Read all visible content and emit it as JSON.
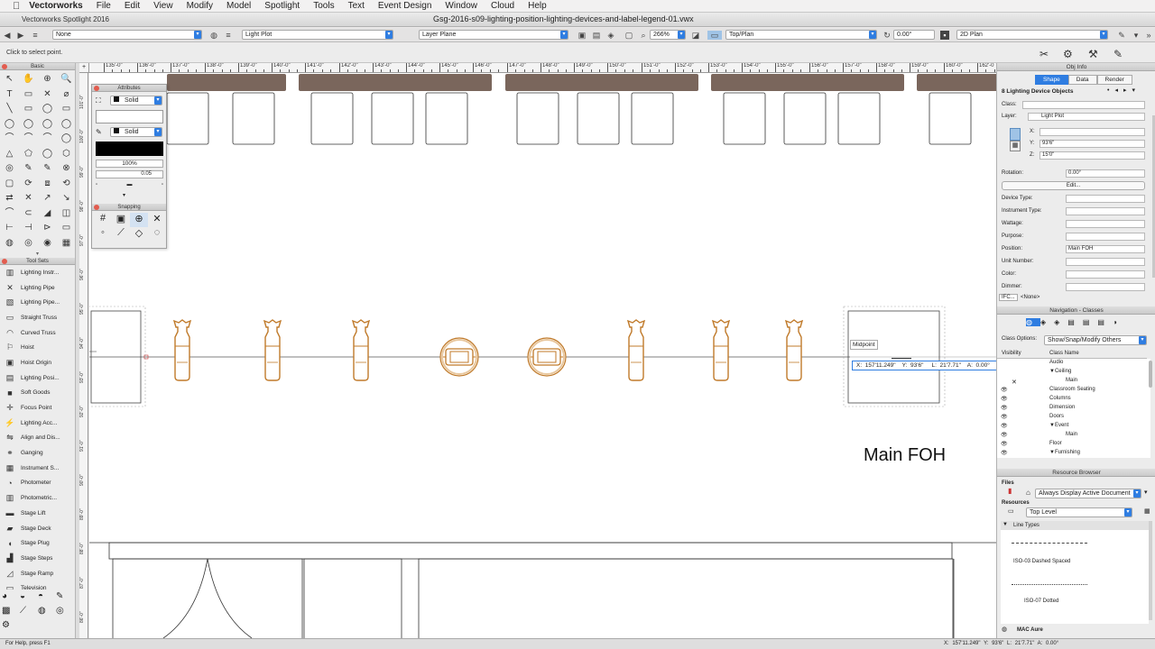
{
  "menubar": {
    "apple": "",
    "app_name": "Vectorworks",
    "items": [
      "File",
      "Edit",
      "View",
      "Modify",
      "Model",
      "Spotlight",
      "Tools",
      "Text",
      "Event Design",
      "Window",
      "Cloud",
      "Help"
    ]
  },
  "window": {
    "product": "Vectorworks Spotlight 2016",
    "document": "Gsg-2016-s09-lighting-position-lighting-devices-and-label-legend-01.vwx"
  },
  "viewbar": {
    "class_select": "None",
    "layer_select": "Light Plot",
    "plane_select": "Layer Plane",
    "zoom": "266%",
    "view_select": "Top/Plan",
    "angle": "0.00°",
    "render_select": "2D Plan"
  },
  "modebar": {
    "hint": "Click to select point."
  },
  "palettes": {
    "basic_title": "Basic",
    "basic_tools": [
      "↖",
      "✋",
      "⊕",
      "🔍",
      "T",
      "▭",
      "✕",
      "⌀",
      "╲",
      "▭",
      "◯",
      "▭",
      "◯",
      "◯",
      "◯",
      "◯",
      "⌒",
      "⌒",
      "⌒",
      "◯",
      "△",
      "⬠",
      "◯",
      "⬡",
      "◎",
      "✎",
      "✎",
      "⊗",
      "▢",
      "⟳",
      "⧈",
      "⟲",
      "⇄",
      "✕",
      "↗",
      "↘",
      "⌒",
      "⊂",
      "◢",
      "◫",
      "⊢",
      "⊣",
      "⊳",
      "▭",
      "◍",
      "◎",
      "◉",
      "▦"
    ],
    "toolsets_title": "Tool Sets",
    "toolsets": [
      {
        "icon": "▥",
        "label": "Lighting Instr..."
      },
      {
        "icon": "✕",
        "label": "Lighting Pipe"
      },
      {
        "icon": "▧",
        "label": "Lighting Pipe..."
      },
      {
        "icon": "▭",
        "label": "Straight Truss"
      },
      {
        "icon": "◠",
        "label": "Curved Truss"
      },
      {
        "icon": "⚐",
        "label": "Hoist"
      },
      {
        "icon": "▣",
        "label": "Hoist Origin"
      },
      {
        "icon": "▤",
        "label": "Lighting Posi..."
      },
      {
        "icon": "■",
        "label": "Soft Goods"
      },
      {
        "icon": "✛",
        "label": "Focus Point"
      },
      {
        "icon": "⚡",
        "label": "Lighting Acc..."
      },
      {
        "icon": "⇋",
        "label": "Align and Dis..."
      },
      {
        "icon": "⚭",
        "label": "Ganging"
      },
      {
        "icon": "▦",
        "label": "Instrument S..."
      },
      {
        "icon": "◔",
        "label": "Photometer"
      },
      {
        "icon": "▥",
        "label": "Photometric..."
      },
      {
        "icon": "▬",
        "label": "Stage Lift"
      },
      {
        "icon": "▰",
        "label": "Stage Deck"
      },
      {
        "icon": "◖",
        "label": "Stage Plug"
      },
      {
        "icon": "▟",
        "label": "Stage Steps"
      },
      {
        "icon": "◿",
        "label": "Stage Ramp"
      },
      {
        "icon": "▭",
        "label": "Television"
      }
    ],
    "attributes": {
      "title": "Attributes",
      "fill_style": "Solid",
      "pen_style": "Solid",
      "opacity": "100%",
      "line_weight": "0.05"
    },
    "snapping_title": "Snapping"
  },
  "ruler": {
    "h_labels": [
      "135'-0\"",
      "136'-0\"",
      "137'-0\"",
      "138'-0\"",
      "139'-0\"",
      "140'-0\"",
      "141'-0\"",
      "142'-0\"",
      "143'-0\"",
      "144'-0\"",
      "145'-0\"",
      "146'-0\"",
      "147'-0\"",
      "148'-0\"",
      "149'-0\"",
      "150'-0\"",
      "151'-0\"",
      "152'-0\"",
      "153'-0\"",
      "154'-0\"",
      "155'-0\"",
      "156'-0\"",
      "157'-0\"",
      "158'-0\"",
      "159'-0\"",
      "160'-0\"",
      "162'-0"
    ],
    "v_labels": [
      "101'-0\"",
      "100'-0\"",
      "99'-0\"",
      "98'-0\"",
      "97'-0\"",
      "96'-0\"",
      "95'-0\"",
      "94'-0\"",
      "93'-0\"",
      "92'-0\"",
      "91'-0\"",
      "90'-0\"",
      "89'-0\"",
      "88'-0\"",
      "87'-0\"",
      "86'-0\""
    ]
  },
  "drawing": {
    "snap_label": "Midpoint",
    "floating_data": "X:  157'11.249\"    Y:  93'6\"     L:  21'7.71\"    A:  0.00°",
    "position_label": "Main FOH",
    "fixture_color": "#c07a2a",
    "truss_color": "#7a665c"
  },
  "obj_info": {
    "title": "Obj Info",
    "tabs": [
      "Shape",
      "Data",
      "Render"
    ],
    "selection": "8 Lighting Device Objects",
    "class_label": "Class:",
    "class_value": "",
    "layer_label": "Layer:",
    "layer_value": "Light Plot",
    "x_label": "X:",
    "x_value": "",
    "y_label": "Y:",
    "y_value": "93'6\"",
    "z_label": "Z:",
    "z_value": "15'0\"",
    "rotation_label": "Rotation:",
    "rotation_value": "0.00°",
    "edit_button": "Edit...",
    "fields": [
      {
        "label": "Device Type:",
        "value": ""
      },
      {
        "label": "Instrument Type:",
        "value": ""
      },
      {
        "label": "Wattage:",
        "value": ""
      },
      {
        "label": "Purpose:",
        "value": ""
      },
      {
        "label": "Position:",
        "value": "Main FOH"
      },
      {
        "label": "Unit Number:",
        "value": ""
      },
      {
        "label": "Color:",
        "value": ""
      },
      {
        "label": "Dimmer:",
        "value": ""
      }
    ],
    "ifc_label": "IFC...",
    "ifc_value": "<None>"
  },
  "nav": {
    "title": "Navigation - Classes",
    "options_label": "Class Options:",
    "options_value": "Show/Snap/Modify Others",
    "col_visibility": "Visibility",
    "col_name": "Class Name",
    "rows": [
      {
        "vis": "",
        "indent": 0,
        "name": "Audio"
      },
      {
        "vis": "",
        "indent": 0,
        "name": "▼Ceiling"
      },
      {
        "vis": "",
        "indent": 1,
        "name": "Main"
      },
      {
        "vis": "👁",
        "indent": 0,
        "name": "Classroom Seating"
      },
      {
        "vis": "👁",
        "indent": 0,
        "name": "Columns"
      },
      {
        "vis": "👁",
        "indent": 0,
        "name": "Dimension"
      },
      {
        "vis": "👁",
        "indent": 0,
        "name": "Doors"
      },
      {
        "vis": "👁",
        "indent": 0,
        "name": "▼Event"
      },
      {
        "vis": "👁",
        "indent": 1,
        "name": "Main"
      },
      {
        "vis": "👁",
        "indent": 0,
        "name": "Floor"
      },
      {
        "vis": "👁",
        "indent": 0,
        "name": "▼Furnishing"
      }
    ]
  },
  "resource": {
    "title": "Resource Browser",
    "files_label": "Files",
    "files_value": "Always Display Active Document",
    "resources_label": "Resources",
    "resources_value": "Top Level",
    "group": "Line Types",
    "items": [
      "ISO-03 Dashed Spaced",
      "ISO-07 Dotted"
    ],
    "footer": "MAC Aure"
  },
  "statusbar": {
    "left": "For Help, press F1",
    "right": "X: 157'11.249\"   Y: 93'6\"   L: 21'7.71\"   A: 0.00°"
  }
}
